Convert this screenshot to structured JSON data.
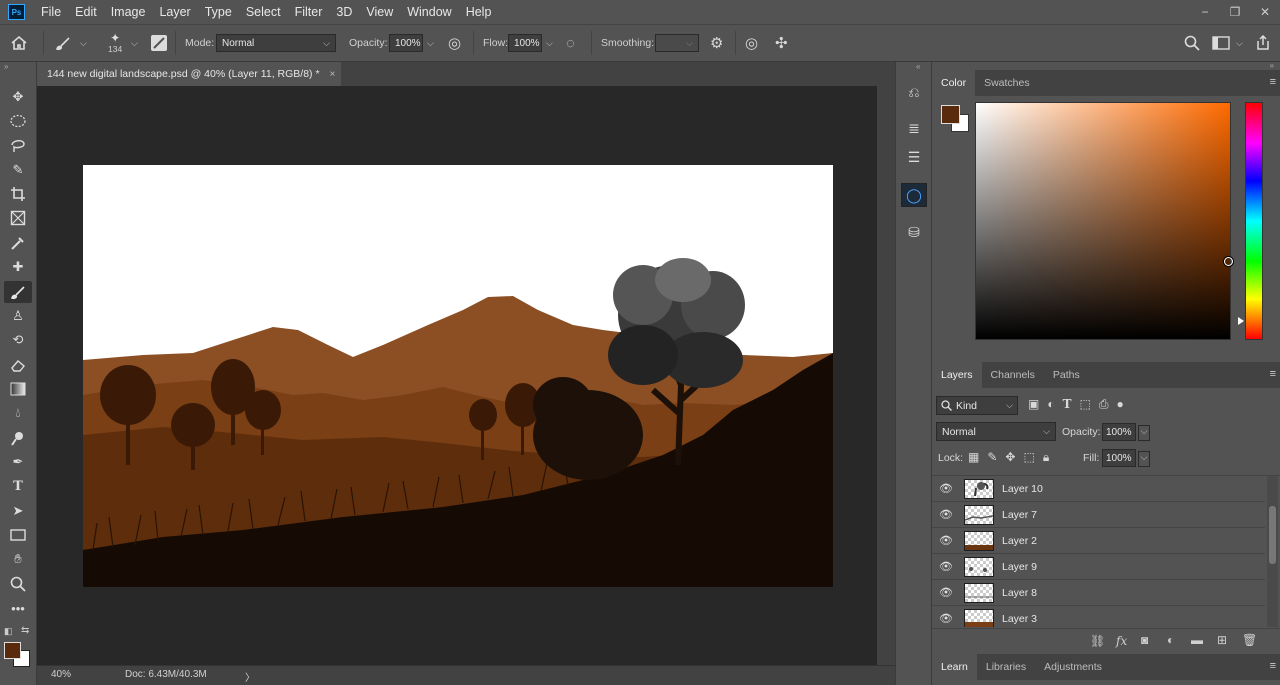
{
  "app": {
    "logo": "Ps"
  },
  "menu": [
    "File",
    "Edit",
    "Image",
    "Layer",
    "Type",
    "Select",
    "Filter",
    "3D",
    "View",
    "Window",
    "Help"
  ],
  "window_controls": {
    "minimize": "−",
    "restore": "❐",
    "close": "✕"
  },
  "options": {
    "brush_size": "134",
    "mode_label": "Mode:",
    "mode_value": "Normal",
    "opacity_label": "Opacity:",
    "opacity_value": "100%",
    "flow_label": "Flow:",
    "flow_value": "100%",
    "smoothing_label": "Smoothing:",
    "smoothing_value": ""
  },
  "document": {
    "tab_title": "144 new digital landscape.psd @ 40% (Layer 11, RGB/8) *",
    "close": "×"
  },
  "status": {
    "zoom": "40%",
    "doc": "Doc: 6.43M/40.3M",
    "arrow": "〉"
  },
  "color_panel": {
    "tabs": [
      "Color",
      "Swatches"
    ],
    "foreground": "#5a2a0c",
    "background": "#ffffff",
    "hue": "#ff6a00"
  },
  "layers_panel": {
    "tabs": [
      "Layers",
      "Channels",
      "Paths"
    ],
    "filter_value": "Kind",
    "blend_mode": "Normal",
    "opacity_label": "Opacity:",
    "opacity_value": "100%",
    "lock_label": "Lock:",
    "fill_label": "Fill:",
    "fill_value": "100%",
    "layers": [
      {
        "name": "Layer 10",
        "thumb": "tree"
      },
      {
        "name": "Layer 7",
        "thumb": "hills"
      },
      {
        "name": "Layer 2",
        "thumb": "ground"
      },
      {
        "name": "Layer 9",
        "thumb": "trees"
      },
      {
        "name": "Layer 8",
        "thumb": "line"
      },
      {
        "name": "Layer 3",
        "thumb": "ground"
      }
    ]
  },
  "bottom_panel": {
    "tabs": [
      "Learn",
      "Libraries",
      "Adjustments"
    ]
  },
  "colors": {
    "ui_dark": "#282828",
    "ui_mid": "#535353",
    "accent": "#31a8ff",
    "foreground_brown": "#5a2a0c"
  }
}
